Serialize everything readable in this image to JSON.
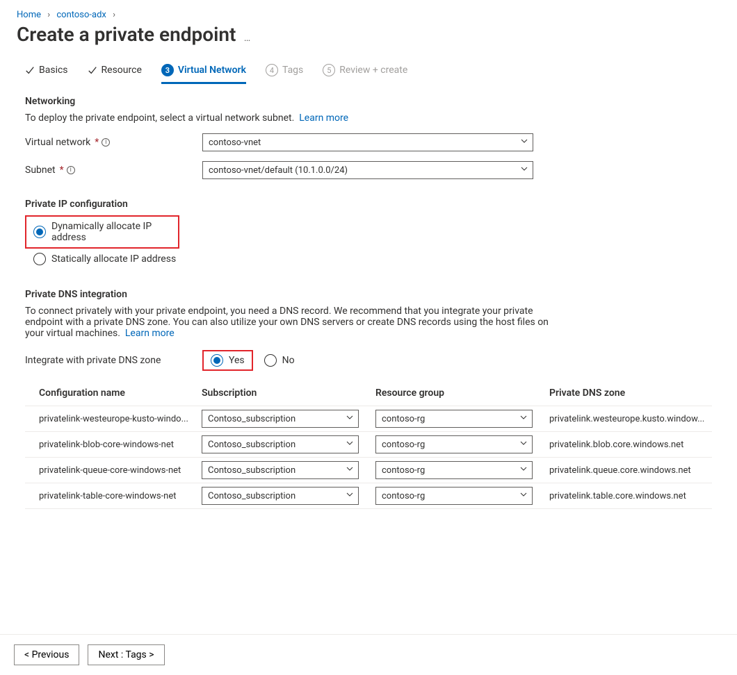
{
  "breadcrumb": {
    "home": "Home",
    "item1": "contoso-adx"
  },
  "page": {
    "title": "Create a private endpoint"
  },
  "tabs": {
    "basics": "Basics",
    "resource": "Resource",
    "vnet_num": "3",
    "vnet": "Virtual Network",
    "tags_num": "4",
    "tags": "Tags",
    "review_num": "5",
    "review": "Review + create"
  },
  "networking": {
    "heading": "Networking",
    "desc": "To deploy the private endpoint, select a virtual network subnet.",
    "learn_more": "Learn more",
    "vnet_label": "Virtual network",
    "vnet_value": "contoso-vnet",
    "subnet_label": "Subnet",
    "subnet_value": "contoso-vnet/default (10.1.0.0/24)"
  },
  "ipconfig": {
    "heading": "Private IP configuration",
    "dynamic": "Dynamically allocate IP address",
    "static": "Statically allocate IP address"
  },
  "dns": {
    "heading": "Private DNS integration",
    "desc": "To connect privately with your private endpoint, you need a DNS record. We recommend that you integrate your private endpoint with a private DNS zone. You can also utilize your own DNS servers or create DNS records using the host files on your virtual machines.",
    "learn_more": "Learn more",
    "integrate_label": "Integrate with private DNS zone",
    "yes": "Yes",
    "no": "No",
    "table": {
      "headers": {
        "name": "Configuration name",
        "sub": "Subscription",
        "rg": "Resource group",
        "zone": "Private DNS zone"
      },
      "rows": [
        {
          "name": "privatelink-westeurope-kusto-windo...",
          "sub": "Contoso_subscription",
          "rg": "contoso-rg",
          "zone": "privatelink.westeurope.kusto.window..."
        },
        {
          "name": "privatelink-blob-core-windows-net",
          "sub": "Contoso_subscription",
          "rg": "contoso-rg",
          "zone": "privatelink.blob.core.windows.net"
        },
        {
          "name": "privatelink-queue-core-windows-net",
          "sub": "Contoso_subscription",
          "rg": "contoso-rg",
          "zone": "privatelink.queue.core.windows.net"
        },
        {
          "name": "privatelink-table-core-windows-net",
          "sub": "Contoso_subscription",
          "rg": "contoso-rg",
          "zone": "privatelink.table.core.windows.net"
        }
      ]
    }
  },
  "footer": {
    "prev": "< Previous",
    "next": "Next : Tags >"
  }
}
